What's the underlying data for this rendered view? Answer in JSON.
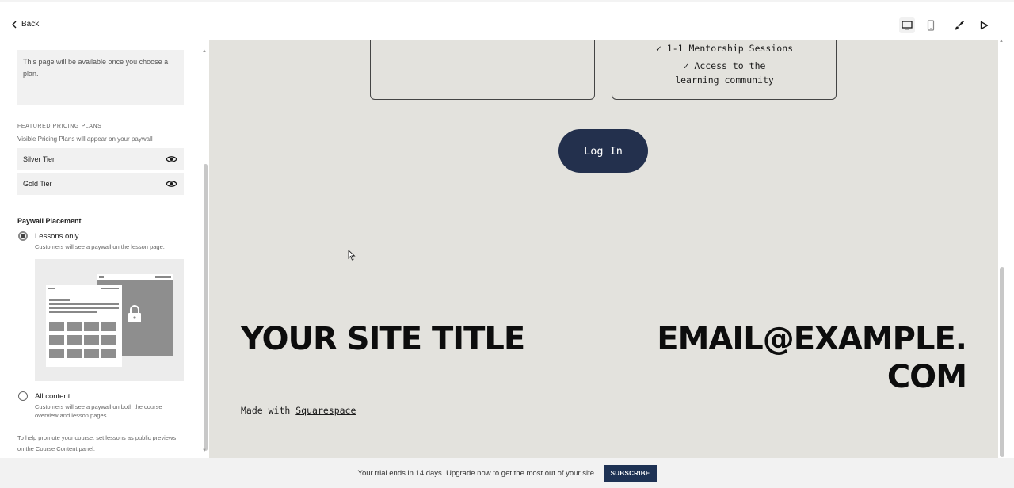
{
  "nav": {
    "back_label": "Back"
  },
  "panel": {
    "notice_text": "This page will be available once you choose a plan.",
    "featured": {
      "title": "FEATURED PRICING PLANS",
      "subtitle": "Visible Pricing Plans will appear on your paywall",
      "plans": [
        {
          "label": "Silver Tier",
          "icon": "eye-icon"
        },
        {
          "label": "Gold Tier",
          "icon": "eye-icon"
        }
      ]
    },
    "paywall": {
      "title": "Paywall Placement",
      "options": [
        {
          "label": "Lessons only",
          "desc": "Customers will see a paywall on the lesson page.",
          "selected": true
        },
        {
          "label": "All content",
          "desc": "Customers will see a paywall on both the course overview and lesson pages.",
          "selected": false
        }
      ]
    },
    "footnote": "To help promote your course, set lessons as public previews on the Course Content panel."
  },
  "toolbar": {
    "icons": [
      "desktop-icon",
      "mobile-icon",
      "brush-icon",
      "play-icon"
    ]
  },
  "preview": {
    "features": [
      "✓ 1-1 Mentorship Sessions",
      "✓ Access to the learning community"
    ],
    "login_label": "Log In",
    "site_title": "YOUR SITE TITLE",
    "email_line1": "EMAIL@EXAMPLE.",
    "email_line2": "COM",
    "made_with": "Made with",
    "made_with_link": "Squarespace",
    "background_color": "#e3e2dd",
    "button_color": "#23304d"
  },
  "trial": {
    "message": "Your trial ends in 14 days. Upgrade now to get the most out of your site.",
    "button_label": "SUBSCRIBE",
    "button_color": "#1e3254"
  }
}
